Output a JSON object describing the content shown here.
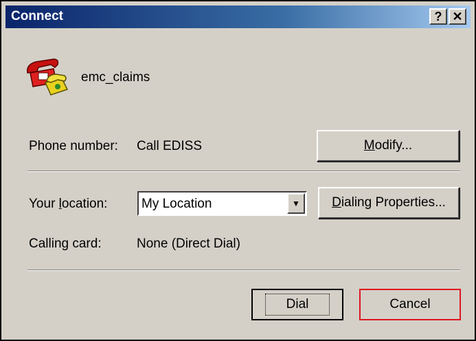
{
  "window": {
    "title": "Connect",
    "help_glyph": "?",
    "close_glyph": "✕"
  },
  "entry": {
    "name": "emc_claims",
    "icon": "dialup-phone-icon"
  },
  "phone": {
    "label": "Phone number:",
    "value": "Call EDISS",
    "modify_button_prefix": "",
    "modify_button_mnemonic": "M",
    "modify_button_rest": "odify..."
  },
  "location": {
    "label_prefix": "Your ",
    "label_mnemonic": "l",
    "label_rest": "ocation:",
    "selected": "My Location",
    "dialing_button_mnemonic": "D",
    "dialing_button_rest": "ialing Properties..."
  },
  "card": {
    "label": "Calling card:",
    "value": "None (Direct Dial)"
  },
  "actions": {
    "dial_label": "Dial",
    "cancel_label": "Cancel"
  },
  "colors": {
    "title_start": "#0a246a",
    "title_end": "#a6caf0",
    "dialog_face": "#d4d0c8",
    "highlight_red": "#e0141e"
  }
}
